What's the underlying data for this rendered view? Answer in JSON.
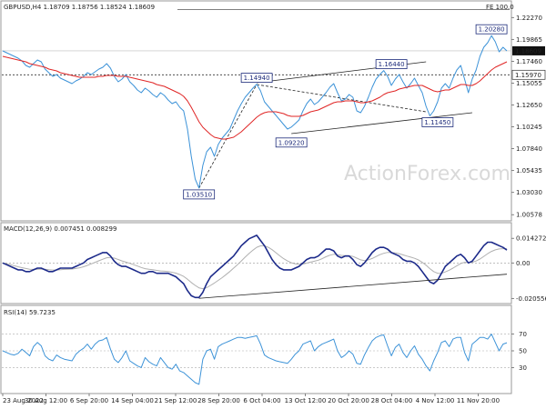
{
  "chart_data": [
    {
      "type": "line",
      "panel": "price",
      "header": "GBPUSD,H4  1.18709 1.18756 1.18524 1.18609",
      "fe_label": "FE 100.0",
      "watermark": "ActionForex.com",
      "ylim": [
        1.0,
        1.24
      ],
      "y_ticks": [
        {
          "v": 1.2227,
          "label": "1.22270"
        },
        {
          "v": 1.19865,
          "label": "1.19865"
        },
        {
          "v": 1.1746,
          "label": "1.17460"
        },
        {
          "v": 1.15055,
          "label": "1.15055"
        },
        {
          "v": 1.1265,
          "label": "1.12650"
        },
        {
          "v": 1.10245,
          "label": "1.10245"
        },
        {
          "v": 1.0784,
          "label": "1.07840"
        },
        {
          "v": 1.05435,
          "label": "1.05435"
        },
        {
          "v": 1.0303,
          "label": "1.03030"
        },
        {
          "v": 1.00578,
          "label": "1.00578"
        }
      ],
      "current_price": {
        "v": 1.18609,
        "label": "1.18609"
      },
      "level_line": {
        "v": 1.1597,
        "label": "1.15970"
      },
      "fe_line": {
        "v": 1.2314
      },
      "x_labels": [
        "23 Aug 2022",
        "30 Aug 12:00",
        "6 Sep 20:00",
        "14 Sep 04:00",
        "21 Sep 12:00",
        "28 Sep 20:00",
        "6 Oct 04:00",
        "13 Oct 12:00",
        "20 Oct 20:00",
        "28 Oct 04:00",
        "4 Nov 12:00",
        "11 Nov 20:00"
      ],
      "close": [
        1.186,
        1.184,
        1.182,
        1.18,
        1.178,
        1.175,
        1.17,
        1.168,
        1.172,
        1.176,
        1.174,
        1.166,
        1.162,
        1.158,
        1.16,
        1.156,
        1.154,
        1.152,
        1.15,
        1.153,
        1.155,
        1.158,
        1.162,
        1.16,
        1.163,
        1.166,
        1.168,
        1.172,
        1.167,
        1.158,
        1.152,
        1.155,
        1.16,
        1.152,
        1.148,
        1.143,
        1.14,
        1.145,
        1.142,
        1.138,
        1.135,
        1.14,
        1.137,
        1.132,
        1.128,
        1.13,
        1.124,
        1.12,
        1.1,
        1.07,
        1.045,
        1.0351,
        1.06,
        1.075,
        1.08,
        1.07,
        1.083,
        1.09,
        1.095,
        1.1,
        1.11,
        1.12,
        1.128,
        1.135,
        1.14,
        1.145,
        1.1494,
        1.142,
        1.13,
        1.125,
        1.12,
        1.115,
        1.11,
        1.105,
        1.1,
        1.1022,
        1.106,
        1.11,
        1.12,
        1.128,
        1.133,
        1.127,
        1.13,
        1.135,
        1.14,
        1.146,
        1.15,
        1.14,
        1.131,
        1.133,
        1.138,
        1.135,
        1.12,
        1.118,
        1.125,
        1.135,
        1.146,
        1.155,
        1.16,
        1.1644,
        1.158,
        1.148,
        1.155,
        1.16,
        1.152,
        1.145,
        1.15,
        1.156,
        1.148,
        1.14,
        1.125,
        1.1145,
        1.12,
        1.13,
        1.145,
        1.15,
        1.145,
        1.156,
        1.165,
        1.17,
        1.155,
        1.14,
        1.155,
        1.165,
        1.18,
        1.19,
        1.195,
        1.2028,
        1.196,
        1.185,
        1.19,
        1.186
      ],
      "ma": [
        1.18,
        1.179,
        1.178,
        1.177,
        1.176,
        1.175,
        1.174,
        1.172,
        1.171,
        1.17,
        1.169,
        1.168,
        1.166,
        1.165,
        1.164,
        1.162,
        1.161,
        1.16,
        1.159,
        1.158,
        1.157,
        1.157,
        1.157,
        1.157,
        1.157,
        1.158,
        1.158,
        1.159,
        1.159,
        1.159,
        1.158,
        1.158,
        1.158,
        1.157,
        1.156,
        1.155,
        1.154,
        1.153,
        1.152,
        1.151,
        1.149,
        1.148,
        1.147,
        1.145,
        1.143,
        1.141,
        1.139,
        1.136,
        1.131,
        1.124,
        1.116,
        1.108,
        1.102,
        1.098,
        1.094,
        1.091,
        1.09,
        1.089,
        1.089,
        1.09,
        1.091,
        1.094,
        1.097,
        1.101,
        1.105,
        1.109,
        1.113,
        1.116,
        1.118,
        1.119,
        1.119,
        1.119,
        1.118,
        1.117,
        1.115,
        1.114,
        1.114,
        1.114,
        1.115,
        1.117,
        1.119,
        1.12,
        1.121,
        1.123,
        1.125,
        1.127,
        1.129,
        1.13,
        1.13,
        1.131,
        1.131,
        1.131,
        1.13,
        1.129,
        1.129,
        1.13,
        1.131,
        1.133,
        1.135,
        1.138,
        1.14,
        1.141,
        1.142,
        1.144,
        1.145,
        1.146,
        1.147,
        1.148,
        1.148,
        1.148,
        1.146,
        1.144,
        1.142,
        1.141,
        1.142,
        1.143,
        1.143,
        1.145,
        1.147,
        1.149,
        1.149,
        1.148,
        1.148,
        1.15,
        1.153,
        1.157,
        1.161,
        1.165,
        1.168,
        1.17,
        1.172,
        1.174
      ],
      "annotations": [
        {
          "label": "1.03510",
          "v": 1.0351,
          "i": 51
        },
        {
          "label": "1.14940",
          "v": 1.1494,
          "i": 66
        },
        {
          "label": "1.09220",
          "v": 1.0922,
          "i": 75
        },
        {
          "label": "1.16440",
          "v": 1.1644,
          "i": 101
        },
        {
          "label": "1.11450",
          "v": 1.1145,
          "i": 113
        },
        {
          "label": "1.20280",
          "v": 1.2028,
          "i": 127
        }
      ],
      "trendlines": [
        {
          "i0": 66,
          "v0": 1.151,
          "i1": 110,
          "v1": 1.174,
          "style": "solid"
        },
        {
          "i0": 75,
          "v0": 1.095,
          "i1": 122,
          "v1": 1.118,
          "style": "solid"
        },
        {
          "i0": 66,
          "v0": 1.149,
          "i1": 110,
          "v1": 1.119,
          "style": "dashed"
        },
        {
          "i0": 51,
          "v0": 1.035,
          "i1": 66,
          "v1": 1.149,
          "style": "dashed"
        }
      ]
    },
    {
      "type": "line",
      "panel": "macd",
      "header": "MACD(12,26,9) 0.007451 0.008299",
      "ylim": [
        -0.023,
        0.0165
      ],
      "y_ticks": [
        {
          "v": 0.014272,
          "label": "0.014272"
        },
        {
          "v": 0.0,
          "label": "0.00"
        },
        {
          "v": -0.020556,
          "label": "-0.020556"
        }
      ],
      "macd": [
        0.0,
        -0.001,
        -0.002,
        -0.003,
        -0.004,
        -0.004,
        -0.005,
        -0.005,
        -0.004,
        -0.003,
        -0.003,
        -0.004,
        -0.005,
        -0.005,
        -0.004,
        -0.003,
        -0.003,
        -0.003,
        -0.003,
        -0.002,
        -0.001,
        0.0,
        0.002,
        0.003,
        0.004,
        0.005,
        0.006,
        0.006,
        0.004,
        0.001,
        -0.001,
        -0.002,
        -0.002,
        -0.003,
        -0.004,
        -0.005,
        -0.006,
        -0.006,
        -0.005,
        -0.005,
        -0.006,
        -0.006,
        -0.006,
        -0.006,
        -0.007,
        -0.008,
        -0.01,
        -0.012,
        -0.016,
        -0.019,
        -0.02,
        -0.02,
        -0.017,
        -0.012,
        -0.008,
        -0.006,
        -0.004,
        -0.002,
        0.0,
        0.002,
        0.004,
        0.007,
        0.01,
        0.012,
        0.014,
        0.015,
        0.016,
        0.013,
        0.01,
        0.006,
        0.002,
        -0.001,
        -0.003,
        -0.004,
        -0.004,
        -0.004,
        -0.003,
        -0.002,
        0.0,
        0.002,
        0.003,
        0.003,
        0.004,
        0.006,
        0.008,
        0.008,
        0.007,
        0.004,
        0.003,
        0.004,
        0.004,
        0.002,
        -0.001,
        -0.002,
        0.0,
        0.003,
        0.006,
        0.008,
        0.009,
        0.009,
        0.008,
        0.006,
        0.005,
        0.004,
        0.002,
        0.001,
        0.001,
        0.0,
        -0.002,
        -0.005,
        -0.008,
        -0.011,
        -0.012,
        -0.01,
        -0.006,
        -0.002,
        0.0,
        0.002,
        0.004,
        0.005,
        0.003,
        0.0,
        0.001,
        0.004,
        0.007,
        0.01,
        0.012,
        0.012,
        0.011,
        0.01,
        0.009,
        0.0075
      ],
      "signal": [
        0.0,
        -0.0005,
        -0.001,
        -0.0016,
        -0.0022,
        -0.0027,
        -0.0032,
        -0.0036,
        -0.0037,
        -0.0036,
        -0.0035,
        -0.0036,
        -0.0039,
        -0.0041,
        -0.0041,
        -0.0039,
        -0.0037,
        -0.0036,
        -0.0035,
        -0.0032,
        -0.0028,
        -0.0022,
        -0.0014,
        -0.0005,
        0.0004,
        0.0013,
        0.0022,
        0.003,
        0.0032,
        0.0028,
        0.002,
        0.0012,
        0.0005,
        -0.0002,
        -0.001,
        -0.0018,
        -0.0026,
        -0.0033,
        -0.0036,
        -0.0039,
        -0.0043,
        -0.0046,
        -0.0048,
        -0.005,
        -0.0054,
        -0.0059,
        -0.0067,
        -0.0078,
        -0.0094,
        -0.0113,
        -0.013,
        -0.0144,
        -0.0149,
        -0.0143,
        -0.013,
        -0.0116,
        -0.0101,
        -0.0085,
        -0.0068,
        -0.005,
        -0.003,
        -0.001,
        0.0012,
        0.0034,
        0.0055,
        0.0074,
        0.0091,
        0.0099,
        0.0099,
        0.0091,
        0.0077,
        0.0059,
        0.0041,
        0.0025,
        0.0012,
        0.0001,
        -0.0005,
        -0.0008,
        -0.0006,
        -0.0001,
        0.0005,
        0.001,
        0.0016,
        0.0025,
        0.0036,
        0.0045,
        0.005,
        0.0048,
        0.0044,
        0.0043,
        0.0042,
        0.0038,
        0.0028,
        0.0018,
        0.0014,
        0.0018,
        0.0026,
        0.0037,
        0.0048,
        0.0056,
        0.0061,
        0.006,
        0.0058,
        0.0054,
        0.0047,
        0.004,
        0.0034,
        0.0027,
        0.0018,
        0.0004,
        -0.0013,
        -0.0033,
        -0.005,
        -0.006,
        -0.006,
        -0.0052,
        -0.0042,
        -0.003,
        -0.0016,
        -0.0003,
        0.0004,
        0.0003,
        0.0004,
        0.0011,
        0.0023,
        0.0038,
        0.0054,
        0.0067,
        0.0076,
        0.0081,
        0.0083,
        0.0083
      ],
      "trendline": {
        "i0": 51,
        "v0": -0.0205,
        "i1": 131,
        "v1": -0.0065
      }
    },
    {
      "type": "line",
      "panel": "rsi",
      "header": "RSI(14) 59.7235",
      "ylim": [
        0,
        100
      ],
      "y_ticks": [
        {
          "v": 70,
          "label": "70"
        },
        {
          "v": 50,
          "label": "50"
        },
        {
          "v": 30,
          "label": "30"
        }
      ],
      "rsi": [
        50,
        48,
        46,
        45,
        47,
        52,
        48,
        44,
        55,
        60,
        56,
        44,
        40,
        38,
        45,
        42,
        40,
        39,
        38,
        46,
        50,
        53,
        58,
        52,
        58,
        62,
        63,
        66,
        52,
        40,
        36,
        42,
        50,
        38,
        35,
        32,
        30,
        42,
        37,
        34,
        32,
        42,
        36,
        30,
        28,
        34,
        26,
        24,
        20,
        16,
        12,
        10,
        40,
        50,
        52,
        40,
        55,
        58,
        60,
        62,
        64,
        66,
        66,
        65,
        66,
        67,
        68,
        58,
        45,
        42,
        40,
        38,
        37,
        36,
        35,
        40,
        46,
        50,
        58,
        60,
        62,
        50,
        55,
        58,
        60,
        62,
        64,
        50,
        42,
        45,
        50,
        46,
        35,
        34,
        45,
        54,
        62,
        66,
        68,
        69,
        56,
        44,
        54,
        58,
        48,
        42,
        50,
        56,
        46,
        40,
        32,
        26,
        38,
        48,
        60,
        62,
        55,
        64,
        66,
        66,
        48,
        38,
        58,
        62,
        66,
        66,
        64,
        70,
        60,
        50,
        58,
        59.7
      ]
    }
  ]
}
